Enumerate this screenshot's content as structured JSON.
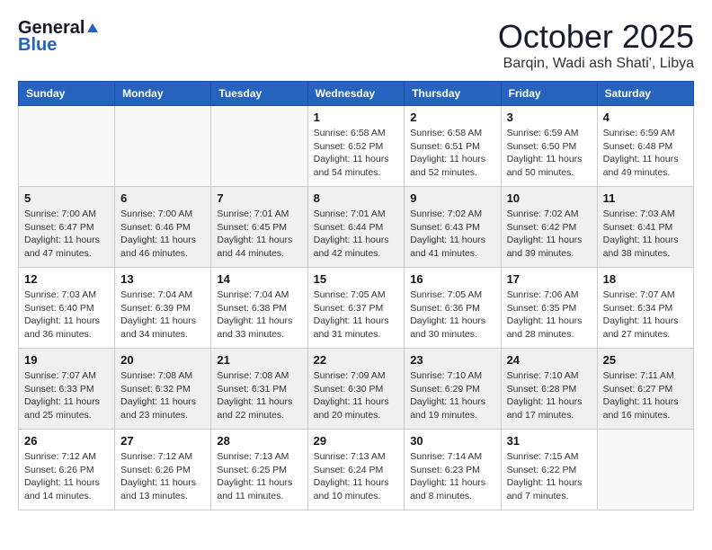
{
  "header": {
    "logo_general": "General",
    "logo_blue": "Blue",
    "month": "October 2025",
    "location": "Barqin, Wadi ash Shati', Libya"
  },
  "days_of_week": [
    "Sunday",
    "Monday",
    "Tuesday",
    "Wednesday",
    "Thursday",
    "Friday",
    "Saturday"
  ],
  "weeks": [
    {
      "shaded": false,
      "days": [
        {
          "num": "",
          "info": ""
        },
        {
          "num": "",
          "info": ""
        },
        {
          "num": "",
          "info": ""
        },
        {
          "num": "1",
          "info": "Sunrise: 6:58 AM\nSunset: 6:52 PM\nDaylight: 11 hours\nand 54 minutes."
        },
        {
          "num": "2",
          "info": "Sunrise: 6:58 AM\nSunset: 6:51 PM\nDaylight: 11 hours\nand 52 minutes."
        },
        {
          "num": "3",
          "info": "Sunrise: 6:59 AM\nSunset: 6:50 PM\nDaylight: 11 hours\nand 50 minutes."
        },
        {
          "num": "4",
          "info": "Sunrise: 6:59 AM\nSunset: 6:48 PM\nDaylight: 11 hours\nand 49 minutes."
        }
      ]
    },
    {
      "shaded": true,
      "days": [
        {
          "num": "5",
          "info": "Sunrise: 7:00 AM\nSunset: 6:47 PM\nDaylight: 11 hours\nand 47 minutes."
        },
        {
          "num": "6",
          "info": "Sunrise: 7:00 AM\nSunset: 6:46 PM\nDaylight: 11 hours\nand 46 minutes."
        },
        {
          "num": "7",
          "info": "Sunrise: 7:01 AM\nSunset: 6:45 PM\nDaylight: 11 hours\nand 44 minutes."
        },
        {
          "num": "8",
          "info": "Sunrise: 7:01 AM\nSunset: 6:44 PM\nDaylight: 11 hours\nand 42 minutes."
        },
        {
          "num": "9",
          "info": "Sunrise: 7:02 AM\nSunset: 6:43 PM\nDaylight: 11 hours\nand 41 minutes."
        },
        {
          "num": "10",
          "info": "Sunrise: 7:02 AM\nSunset: 6:42 PM\nDaylight: 11 hours\nand 39 minutes."
        },
        {
          "num": "11",
          "info": "Sunrise: 7:03 AM\nSunset: 6:41 PM\nDaylight: 11 hours\nand 38 minutes."
        }
      ]
    },
    {
      "shaded": false,
      "days": [
        {
          "num": "12",
          "info": "Sunrise: 7:03 AM\nSunset: 6:40 PM\nDaylight: 11 hours\nand 36 minutes."
        },
        {
          "num": "13",
          "info": "Sunrise: 7:04 AM\nSunset: 6:39 PM\nDaylight: 11 hours\nand 34 minutes."
        },
        {
          "num": "14",
          "info": "Sunrise: 7:04 AM\nSunset: 6:38 PM\nDaylight: 11 hours\nand 33 minutes."
        },
        {
          "num": "15",
          "info": "Sunrise: 7:05 AM\nSunset: 6:37 PM\nDaylight: 11 hours\nand 31 minutes."
        },
        {
          "num": "16",
          "info": "Sunrise: 7:05 AM\nSunset: 6:36 PM\nDaylight: 11 hours\nand 30 minutes."
        },
        {
          "num": "17",
          "info": "Sunrise: 7:06 AM\nSunset: 6:35 PM\nDaylight: 11 hours\nand 28 minutes."
        },
        {
          "num": "18",
          "info": "Sunrise: 7:07 AM\nSunset: 6:34 PM\nDaylight: 11 hours\nand 27 minutes."
        }
      ]
    },
    {
      "shaded": true,
      "days": [
        {
          "num": "19",
          "info": "Sunrise: 7:07 AM\nSunset: 6:33 PM\nDaylight: 11 hours\nand 25 minutes."
        },
        {
          "num": "20",
          "info": "Sunrise: 7:08 AM\nSunset: 6:32 PM\nDaylight: 11 hours\nand 23 minutes."
        },
        {
          "num": "21",
          "info": "Sunrise: 7:08 AM\nSunset: 6:31 PM\nDaylight: 11 hours\nand 22 minutes."
        },
        {
          "num": "22",
          "info": "Sunrise: 7:09 AM\nSunset: 6:30 PM\nDaylight: 11 hours\nand 20 minutes."
        },
        {
          "num": "23",
          "info": "Sunrise: 7:10 AM\nSunset: 6:29 PM\nDaylight: 11 hours\nand 19 minutes."
        },
        {
          "num": "24",
          "info": "Sunrise: 7:10 AM\nSunset: 6:28 PM\nDaylight: 11 hours\nand 17 minutes."
        },
        {
          "num": "25",
          "info": "Sunrise: 7:11 AM\nSunset: 6:27 PM\nDaylight: 11 hours\nand 16 minutes."
        }
      ]
    },
    {
      "shaded": false,
      "days": [
        {
          "num": "26",
          "info": "Sunrise: 7:12 AM\nSunset: 6:26 PM\nDaylight: 11 hours\nand 14 minutes."
        },
        {
          "num": "27",
          "info": "Sunrise: 7:12 AM\nSunset: 6:26 PM\nDaylight: 11 hours\nand 13 minutes."
        },
        {
          "num": "28",
          "info": "Sunrise: 7:13 AM\nSunset: 6:25 PM\nDaylight: 11 hours\nand 11 minutes."
        },
        {
          "num": "29",
          "info": "Sunrise: 7:13 AM\nSunset: 6:24 PM\nDaylight: 11 hours\nand 10 minutes."
        },
        {
          "num": "30",
          "info": "Sunrise: 7:14 AM\nSunset: 6:23 PM\nDaylight: 11 hours\nand 8 minutes."
        },
        {
          "num": "31",
          "info": "Sunrise: 7:15 AM\nSunset: 6:22 PM\nDaylight: 11 hours\nand 7 minutes."
        },
        {
          "num": "",
          "info": ""
        }
      ]
    }
  ]
}
